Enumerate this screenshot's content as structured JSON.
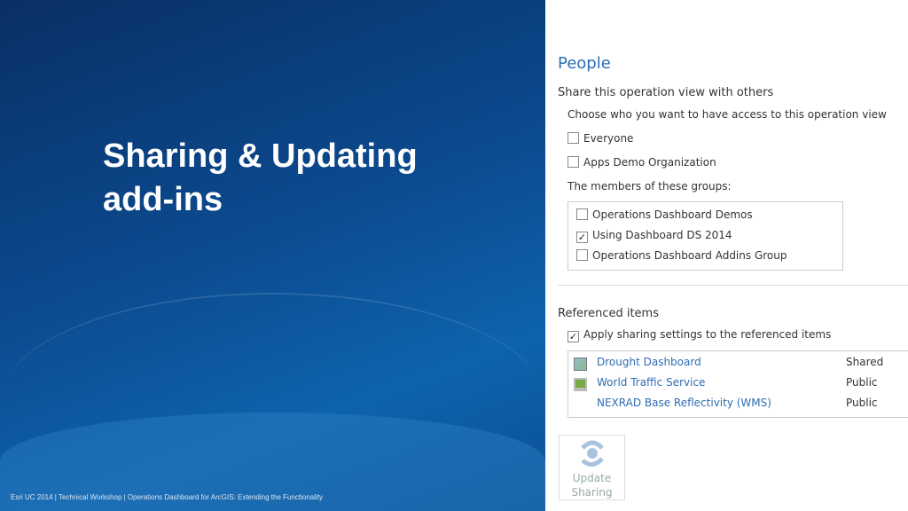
{
  "slide": {
    "title_line1": "Sharing & Updating",
    "title_line2": "add-ins",
    "footer": "Esri UC 2014 | Technical Workshop |  Operations Dashboard for ArcGIS: Extending the Functionality"
  },
  "people": {
    "heading": "People",
    "subheading": "Share this operation view with others",
    "prompt": "Choose who you want to have access to this operation view",
    "options": [
      {
        "label": "Everyone",
        "checked": false
      },
      {
        "label": "Apps Demo Organization",
        "checked": false
      }
    ],
    "groups_label": "The members of these groups:",
    "groups": [
      {
        "label": "Operations Dashboard Demos",
        "checked": false
      },
      {
        "label": "Using Dashboard DS 2014",
        "checked": true
      },
      {
        "label": "Operations Dashboard Addins Group",
        "checked": false
      }
    ]
  },
  "referenced": {
    "heading": "Referenced items",
    "apply_label": "Apply sharing settings to the referenced items",
    "apply_checked": true,
    "items": [
      {
        "name": "Drought Dashboard",
        "status": "Shared"
      },
      {
        "name": "World Traffic Service",
        "status": "Public"
      },
      {
        "name": "NEXRAD Base Reflectivity (WMS)",
        "status": "Public"
      }
    ]
  },
  "update_button": {
    "line1": "Update",
    "line2": "Sharing"
  }
}
